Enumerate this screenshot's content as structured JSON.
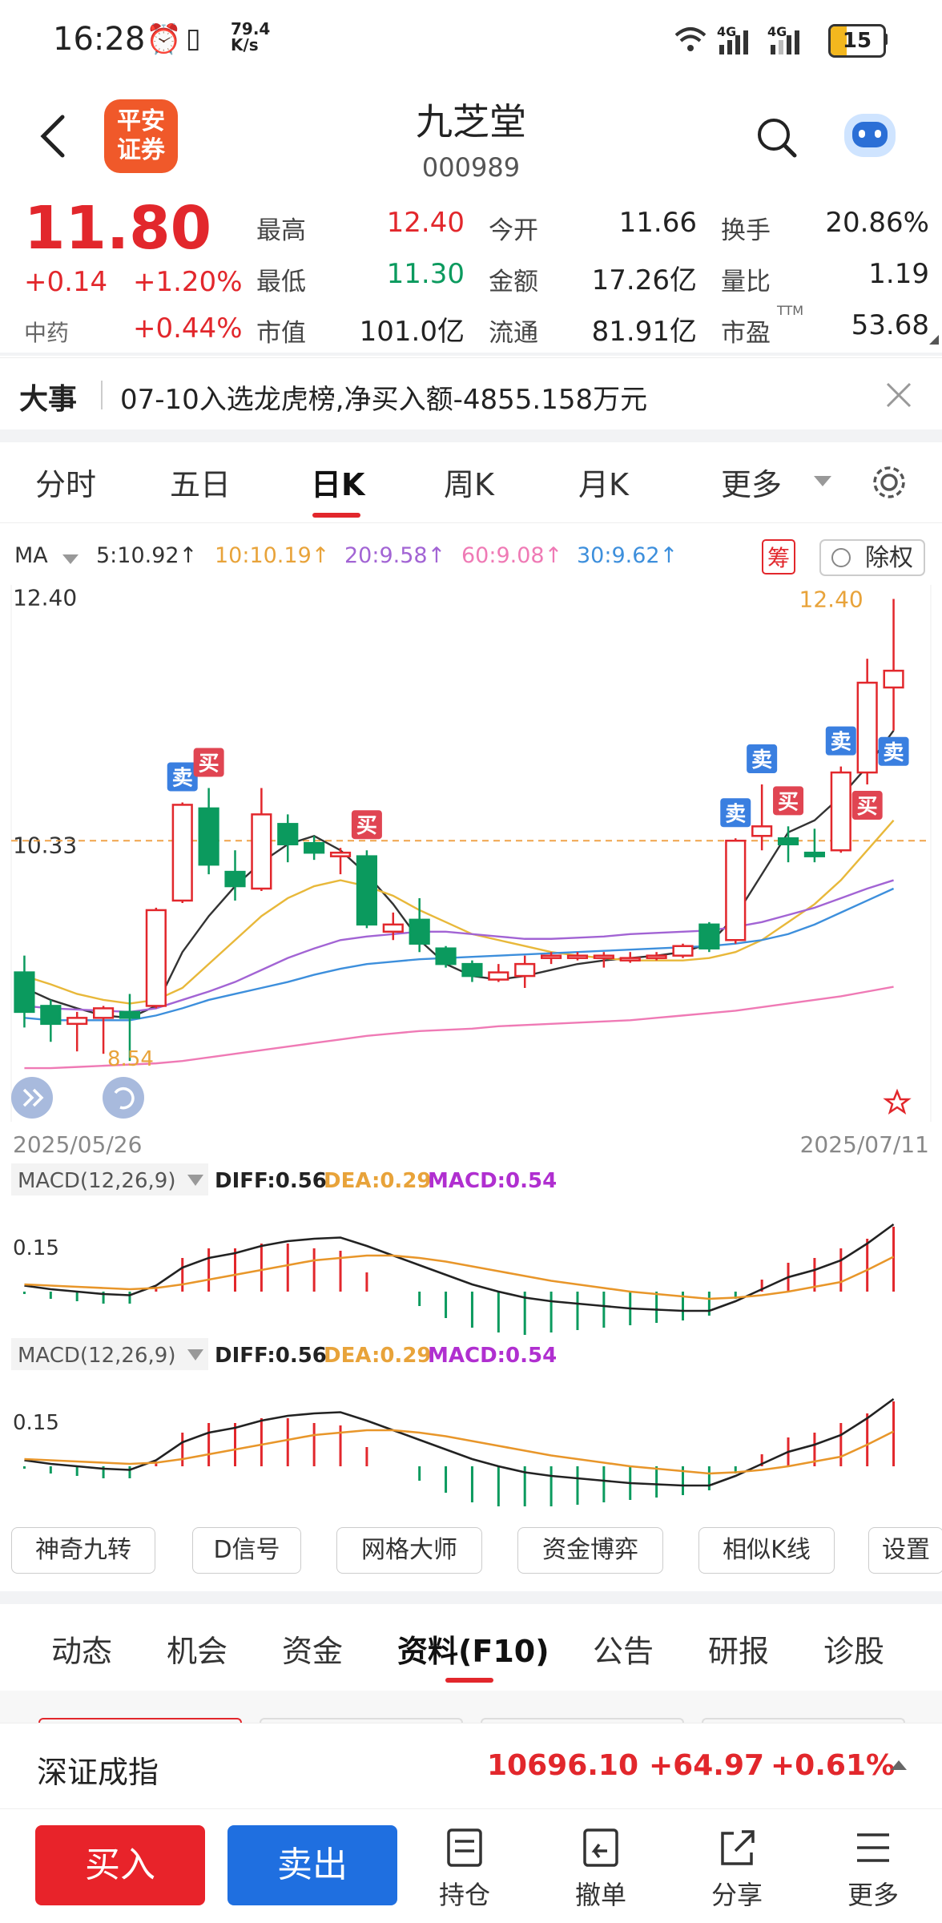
{
  "status_bar": {
    "time": "16:28",
    "net_speed_value": "79.4",
    "net_speed_unit": "K/s",
    "signal_1": "4G",
    "signal_2": "4G",
    "battery": "15"
  },
  "header": {
    "logo_line1": "平安",
    "logo_line2": "证券",
    "stock_name": "九芝堂",
    "stock_code": "000989"
  },
  "quote": {
    "price": "11.80",
    "change": "+0.14",
    "change_pct": "+1.20%",
    "sector_name": "中药",
    "sector_pct": "+0.44%",
    "rows": [
      [
        {
          "label": "最高",
          "value": "12.40",
          "color": "red"
        },
        {
          "label": "今开",
          "value": "11.66",
          "color": "dark"
        },
        {
          "label": "换手",
          "value": "20.86%",
          "color": "dark"
        }
      ],
      [
        {
          "label": "最低",
          "value": "11.30",
          "color": "green"
        },
        {
          "label": "金额",
          "value": "17.26亿",
          "color": "dark"
        },
        {
          "label": "量比",
          "value": "1.19",
          "color": "dark"
        }
      ],
      [
        {
          "label": "市值",
          "value": "101.0亿",
          "color": "dark"
        },
        {
          "label": "流通",
          "value": "81.91亿",
          "color": "dark"
        },
        {
          "label": "市盈",
          "value": "53.68",
          "color": "dark",
          "sup": "TTM"
        }
      ]
    ]
  },
  "news": {
    "tag": "大事",
    "text": "07-10入选龙虎榜,净买入额-4855.158万元"
  },
  "kline_tabs": [
    "分时",
    "五日",
    "日K",
    "周K",
    "月K",
    "更多"
  ],
  "kline_active": 2,
  "ma_legend": {
    "label": "MA",
    "items": [
      {
        "text": "5:10.92↑",
        "color": "#333333"
      },
      {
        "text": "10:10.19↑",
        "color": "#e8a33a"
      },
      {
        "text": "20:9.58↑",
        "color": "#a264d4"
      },
      {
        "text": "60:9.08↑",
        "color": "#ef7ab5"
      },
      {
        "text": "30:9.62↑",
        "color": "#3d8fdc"
      }
    ],
    "chip_btn": "筹",
    "exright_btn": "除权"
  },
  "chart_data": {
    "type": "candlestick",
    "y_labels": [
      "12.40",
      "10.33"
    ],
    "high_label": "12.40",
    "low_label": "8.54",
    "start_date": "2025/05/26",
    "end_date": "2025/07/11",
    "ylim": [
      8.3,
      12.45
    ],
    "candles": [
      {
        "o": 9.28,
        "c": 8.95,
        "h": 9.42,
        "l": 8.82
      },
      {
        "o": 9.0,
        "c": 8.85,
        "h": 9.05,
        "l": 8.7
      },
      {
        "o": 8.85,
        "c": 8.9,
        "h": 8.95,
        "l": 8.62
      },
      {
        "o": 8.9,
        "c": 8.98,
        "h": 9.0,
        "l": 8.6
      },
      {
        "o": 8.95,
        "c": 8.9,
        "h": 9.1,
        "l": 8.54
      },
      {
        "o": 9.0,
        "c": 9.8,
        "h": 9.82,
        "l": 8.98
      },
      {
        "o": 9.88,
        "c": 10.68,
        "h": 10.7,
        "l": 9.86
      },
      {
        "o": 10.65,
        "c": 10.18,
        "h": 10.82,
        "l": 10.1
      },
      {
        "o": 10.12,
        "c": 10.0,
        "h": 10.3,
        "l": 9.88
      },
      {
        "o": 9.98,
        "c": 10.6,
        "h": 10.82,
        "l": 9.96
      },
      {
        "o": 10.52,
        "c": 10.35,
        "h": 10.6,
        "l": 10.2
      },
      {
        "o": 10.36,
        "c": 10.28,
        "h": 10.42,
        "l": 10.22
      },
      {
        "o": 10.25,
        "c": 10.28,
        "h": 10.32,
        "l": 10.1
      },
      {
        "o": 10.25,
        "c": 9.68,
        "h": 10.3,
        "l": 9.65
      },
      {
        "o": 9.62,
        "c": 9.68,
        "h": 9.78,
        "l": 9.55
      },
      {
        "o": 9.72,
        "c": 9.52,
        "h": 9.9,
        "l": 9.45
      },
      {
        "o": 9.48,
        "c": 9.35,
        "h": 9.5,
        "l": 9.32
      },
      {
        "o": 9.35,
        "c": 9.25,
        "h": 9.38,
        "l": 9.2
      },
      {
        "o": 9.22,
        "c": 9.28,
        "h": 9.35,
        "l": 9.2
      },
      {
        "o": 9.25,
        "c": 9.35,
        "h": 9.42,
        "l": 9.15
      },
      {
        "o": 9.4,
        "c": 9.42,
        "h": 9.45,
        "l": 9.35
      },
      {
        "o": 9.4,
        "c": 9.42,
        "h": 9.45,
        "l": 9.38
      },
      {
        "o": 9.4,
        "c": 9.42,
        "h": 9.45,
        "l": 9.32
      },
      {
        "o": 9.38,
        "c": 9.4,
        "h": 9.45,
        "l": 9.36
      },
      {
        "o": 9.4,
        "c": 9.42,
        "h": 9.45,
        "l": 9.38
      },
      {
        "o": 9.42,
        "c": 9.5,
        "h": 9.52,
        "l": 9.4
      },
      {
        "o": 9.68,
        "c": 9.48,
        "h": 9.7,
        "l": 9.45
      },
      {
        "o": 9.55,
        "c": 10.38,
        "h": 10.4,
        "l": 9.52
      },
      {
        "o": 10.42,
        "c": 10.5,
        "h": 10.85,
        "l": 10.3
      },
      {
        "o": 10.4,
        "c": 10.35,
        "h": 10.5,
        "l": 10.2
      },
      {
        "o": 10.28,
        "c": 10.25,
        "h": 10.48,
        "l": 10.2
      },
      {
        "o": 10.3,
        "c": 10.95,
        "h": 11.0,
        "l": 10.28
      },
      {
        "o": 10.95,
        "c": 11.7,
        "h": 11.9,
        "l": 10.85
      },
      {
        "o": 11.66,
        "c": 11.8,
        "h": 12.4,
        "l": 11.3
      }
    ],
    "signals": [
      {
        "type": "卖",
        "i": 6,
        "pos": "above"
      },
      {
        "type": "买",
        "i": 7,
        "pos": "above"
      },
      {
        "type": "买",
        "i": 13,
        "pos": "above"
      },
      {
        "type": "卖",
        "i": 27,
        "pos": "above"
      },
      {
        "type": "卖",
        "i": 28,
        "pos": "above"
      },
      {
        "type": "买",
        "i": 29,
        "pos": "above"
      },
      {
        "type": "卖",
        "i": 31,
        "pos": "above"
      },
      {
        "type": "买",
        "i": 32,
        "pos": "below"
      },
      {
        "type": "卖",
        "i": 33,
        "pos": "below"
      }
    ],
    "ma_lines": {
      "ma5": [
        9.15,
        9.05,
        8.98,
        8.92,
        8.9,
        9.0,
        9.45,
        9.75,
        10.0,
        10.2,
        10.35,
        10.42,
        10.3,
        10.1,
        9.85,
        9.55,
        9.35,
        9.25,
        9.22,
        9.25,
        9.3,
        9.35,
        9.38,
        9.4,
        9.42,
        9.45,
        9.52,
        9.75,
        10.1,
        10.45,
        10.55,
        10.75,
        11.0,
        11.3
      ],
      "ma10": [
        9.25,
        9.18,
        9.1,
        9.05,
        9.02,
        9.05,
        9.15,
        9.35,
        9.55,
        9.75,
        9.9,
        10.0,
        10.05,
        10.0,
        9.92,
        9.8,
        9.7,
        9.6,
        9.55,
        9.5,
        9.45,
        9.42,
        9.4,
        9.38,
        9.38,
        9.38,
        9.4,
        9.45,
        9.55,
        9.7,
        9.85,
        10.05,
        10.3,
        10.55
      ],
      "ma20": [
        9.0,
        8.98,
        8.97,
        8.96,
        8.95,
        8.98,
        9.05,
        9.12,
        9.2,
        9.3,
        9.4,
        9.48,
        9.55,
        9.58,
        9.6,
        9.62,
        9.62,
        9.6,
        9.58,
        9.56,
        9.56,
        9.57,
        9.58,
        9.6,
        9.61,
        9.62,
        9.63,
        9.66,
        9.7,
        9.76,
        9.82,
        9.9,
        9.98,
        10.05
      ],
      "ma30": [
        8.9,
        8.88,
        8.88,
        8.88,
        8.88,
        8.92,
        8.98,
        9.05,
        9.1,
        9.15,
        9.2,
        9.26,
        9.31,
        9.35,
        9.37,
        9.39,
        9.4,
        9.41,
        9.42,
        9.43,
        9.44,
        9.45,
        9.46,
        9.47,
        9.48,
        9.49,
        9.5,
        9.52,
        9.55,
        9.6,
        9.68,
        9.78,
        9.88,
        9.98
      ],
      "ma60": [
        8.48,
        8.48,
        8.49,
        8.5,
        8.51,
        8.52,
        8.54,
        8.57,
        8.6,
        8.63,
        8.66,
        8.69,
        8.72,
        8.75,
        8.77,
        8.79,
        8.8,
        8.81,
        8.83,
        8.84,
        8.85,
        8.86,
        8.87,
        8.88,
        8.9,
        8.92,
        8.94,
        8.96,
        8.99,
        9.02,
        9.05,
        9.08,
        9.12,
        9.16
      ]
    },
    "current_price_line": 10.38
  },
  "macd_panels": [
    {
      "title": "MACD(12,26,9)",
      "diff": "DIFF:0.56",
      "dea": "DEA:0.29",
      "macd": "MACD:0.54",
      "y_label": "0.15"
    },
    {
      "title": "MACD(12,26,9)",
      "diff": "DIFF:0.56",
      "dea": "DEA:0.29",
      "macd": "MACD:0.54",
      "y_label": "0.15"
    }
  ],
  "macd_data": {
    "diff": [
      0.05,
      0.02,
      0.0,
      -0.02,
      -0.03,
      0.05,
      0.2,
      0.28,
      0.32,
      0.38,
      0.42,
      0.44,
      0.45,
      0.38,
      0.3,
      0.22,
      0.14,
      0.06,
      0.0,
      -0.05,
      -0.08,
      -0.1,
      -0.12,
      -0.14,
      -0.15,
      -0.16,
      -0.16,
      -0.08,
      0.02,
      0.12,
      0.18,
      0.26,
      0.4,
      0.56
    ],
    "dea": [
      0.06,
      0.05,
      0.04,
      0.03,
      0.02,
      0.03,
      0.06,
      0.1,
      0.14,
      0.18,
      0.22,
      0.26,
      0.28,
      0.3,
      0.3,
      0.28,
      0.25,
      0.21,
      0.17,
      0.13,
      0.09,
      0.06,
      0.03,
      0.0,
      -0.02,
      -0.04,
      -0.06,
      -0.05,
      -0.03,
      0.0,
      0.04,
      0.08,
      0.18,
      0.29
    ],
    "hist": [
      -0.02,
      -0.06,
      -0.08,
      -0.1,
      -0.1,
      0.04,
      0.28,
      0.36,
      0.36,
      0.4,
      0.4,
      0.36,
      0.34,
      0.16,
      0.0,
      -0.12,
      -0.22,
      -0.3,
      -0.34,
      -0.36,
      -0.34,
      -0.32,
      -0.3,
      -0.28,
      -0.26,
      -0.24,
      -0.2,
      -0.06,
      0.1,
      0.24,
      0.28,
      0.36,
      0.44,
      0.54
    ]
  },
  "indicator_buttons": [
    "神奇九转",
    "D信号",
    "网格大师",
    "资金博弈",
    "相似K线",
    "设置"
  ],
  "info_tabs": [
    "动态",
    "机会",
    "资金",
    "资料(F10)",
    "公告",
    "研报",
    "诊股"
  ],
  "info_active": 3,
  "index_strip": {
    "name": "深证成指",
    "value": "10696.10",
    "change": "+64.97",
    "pct": "+0.61%"
  },
  "bottom_bar": {
    "buy": "买入",
    "sell": "卖出",
    "items": [
      "持仓",
      "撤单",
      "分享",
      "更多"
    ]
  },
  "colors": {
    "up": "#e2272c",
    "down": "#0b9a5e",
    "buy_btn": "#e8232a",
    "sell_btn": "#1f6fe0"
  }
}
